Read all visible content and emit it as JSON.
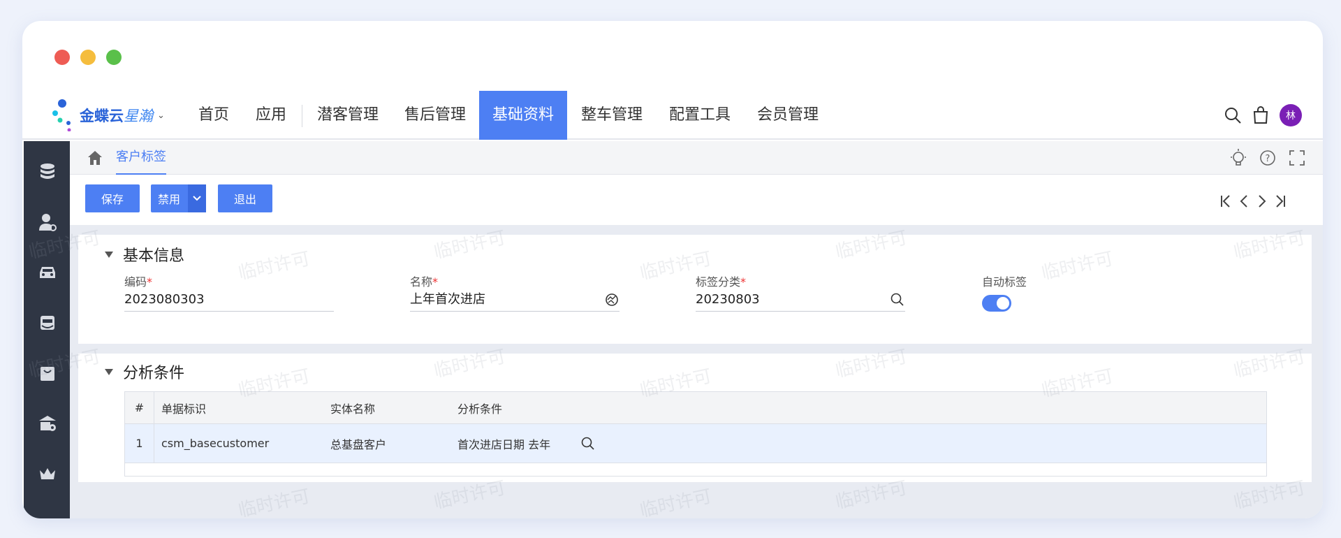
{
  "window": {
    "controls": [
      {
        "name": "close",
        "color": "#ee5c54"
      },
      {
        "name": "minimize",
        "color": "#f5bd3d"
      },
      {
        "name": "maximize",
        "color": "#5ac04a"
      }
    ]
  },
  "brand": {
    "name": "金蝶云",
    "product": "星瀚"
  },
  "nav": {
    "items": [
      "首页",
      "应用",
      "潜客管理",
      "售后管理",
      "基础资料",
      "整车管理",
      "配置工具",
      "会员管理"
    ],
    "active_index": 4
  },
  "user": {
    "avatar_text": "林"
  },
  "colors": {
    "accent": "#4d7ff3",
    "sidebar": "#2f3644",
    "avatar": "#7a1fb5"
  },
  "tab": {
    "label": "客户标签"
  },
  "toolbar": {
    "save_label": "保存",
    "disable_label": "禁用",
    "exit_label": "退出"
  },
  "section_basic": {
    "title": "基本信息",
    "code": {
      "label": "编码",
      "value": "2023080303"
    },
    "name": {
      "label": "名称",
      "value": "上年首次进店"
    },
    "category": {
      "label": "标签分类",
      "value": "20230803"
    },
    "auto": {
      "label": "自动标签",
      "on": true
    }
  },
  "section_analysis": {
    "title": "分析条件",
    "columns": [
      "#",
      "单据标识",
      "实体名称",
      "分析条件"
    ],
    "rows": [
      {
        "num": "1",
        "doc_id": "csm_basecustomer",
        "entity": "总基盘客户",
        "condition": "首次进店日期 去年"
      }
    ]
  },
  "watermark": "临时许可"
}
